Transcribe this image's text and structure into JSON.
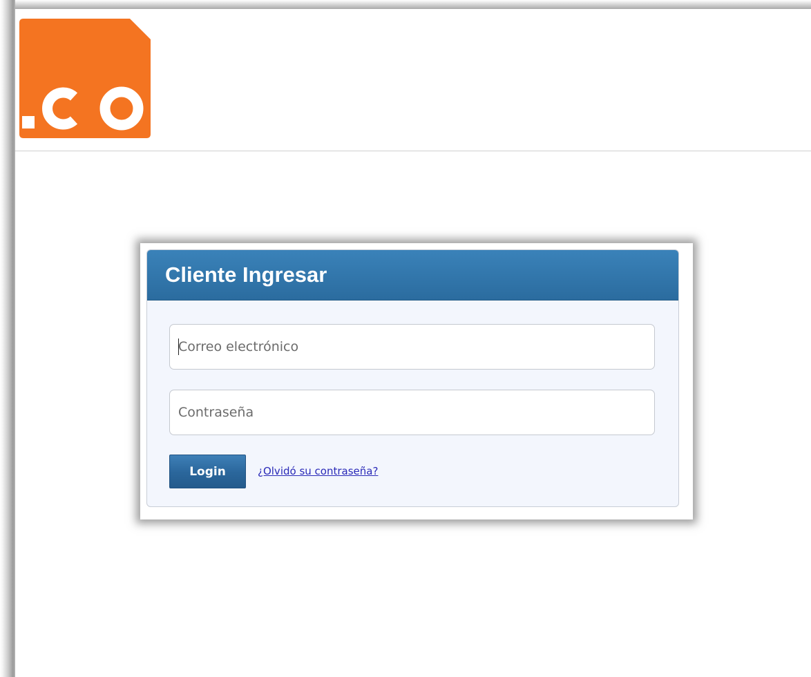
{
  "header": {
    "logo": {
      "text": ".CO",
      "color": "#f47421",
      "icon": "dot-co-logo"
    }
  },
  "login": {
    "title": "Cliente Ingresar",
    "email": {
      "placeholder": "Correo electrónico",
      "value": ""
    },
    "password": {
      "placeholder": "Contraseña",
      "value": ""
    },
    "submit_label": "Login",
    "forgot_label": "¿Olvidó su contraseña?"
  },
  "colors": {
    "panel_header": "#2f73a8",
    "panel_background": "#f3f6fd",
    "button": "#2a669b",
    "link": "#2a2ab8",
    "logo": "#f47421"
  }
}
